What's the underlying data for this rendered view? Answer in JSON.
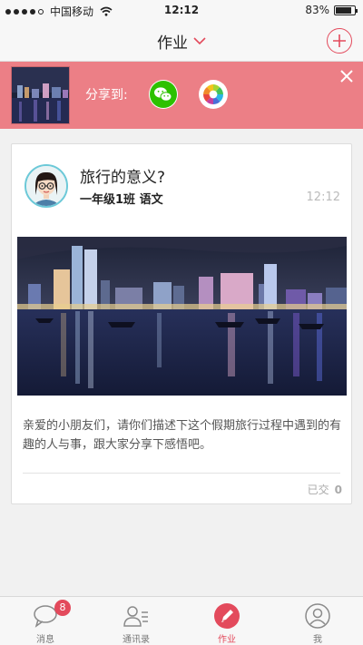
{
  "status_bar": {
    "carrier": "中国移动",
    "time": "12:12",
    "battery": "83%",
    "battery_level": 0.83
  },
  "nav": {
    "title": "作业"
  },
  "share": {
    "label": "分享到:"
  },
  "homework": {
    "title": "旅行的意义?",
    "class_subject": "一年级1班 语文",
    "time": "12:12",
    "description": "亲爱的小朋友们，请你们描述下这个假期旅行过程中遇到的有趣的人与事，跟大家分享下感悟吧。",
    "submitted_label": "已交",
    "submitted_count": "0"
  },
  "tabs": [
    {
      "label": "消息",
      "icon": "chat-bubble-icon",
      "badge": "8"
    },
    {
      "label": "通讯录",
      "icon": "contacts-icon"
    },
    {
      "label": "作业",
      "icon": "pencil-icon"
    },
    {
      "label": "我",
      "icon": "person-icon"
    }
  ],
  "colors": {
    "accent": "#e34a5c",
    "banner": "#ec7f86",
    "wechat_green": "#2dc100"
  }
}
